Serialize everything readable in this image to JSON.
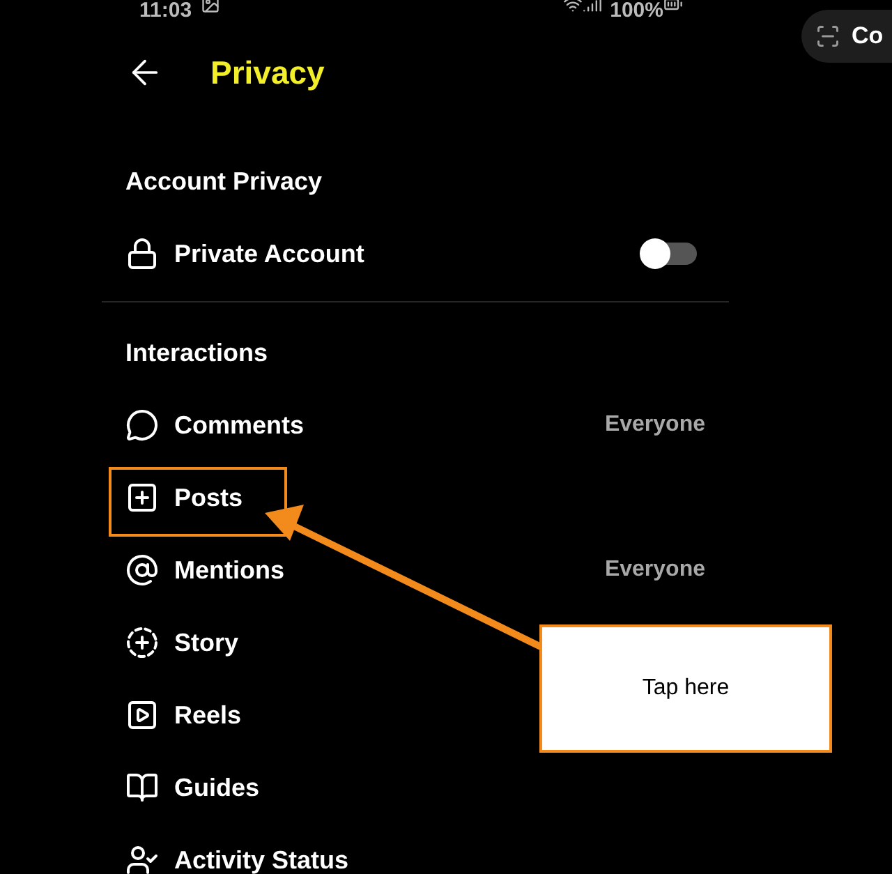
{
  "status_bar": {
    "time": "11:03",
    "battery": "100%"
  },
  "overlay_pill": {
    "label": "Co"
  },
  "header": {
    "title": "Privacy"
  },
  "sections": [
    {
      "title": "Account Privacy",
      "items": [
        {
          "label": "Private Account",
          "kind": "toggle",
          "on": false
        }
      ]
    },
    {
      "title": "Interactions",
      "items": [
        {
          "label": "Comments",
          "kind": "link",
          "value": "Everyone"
        },
        {
          "label": "Posts",
          "kind": "link"
        },
        {
          "label": "Mentions",
          "kind": "link",
          "value": "Everyone"
        },
        {
          "label": "Story",
          "kind": "link"
        },
        {
          "label": "Reels",
          "kind": "link"
        },
        {
          "label": "Guides",
          "kind": "link"
        },
        {
          "label": "Activity Status",
          "kind": "link"
        }
      ]
    }
  ],
  "annotation": {
    "callout": "Tap here"
  }
}
